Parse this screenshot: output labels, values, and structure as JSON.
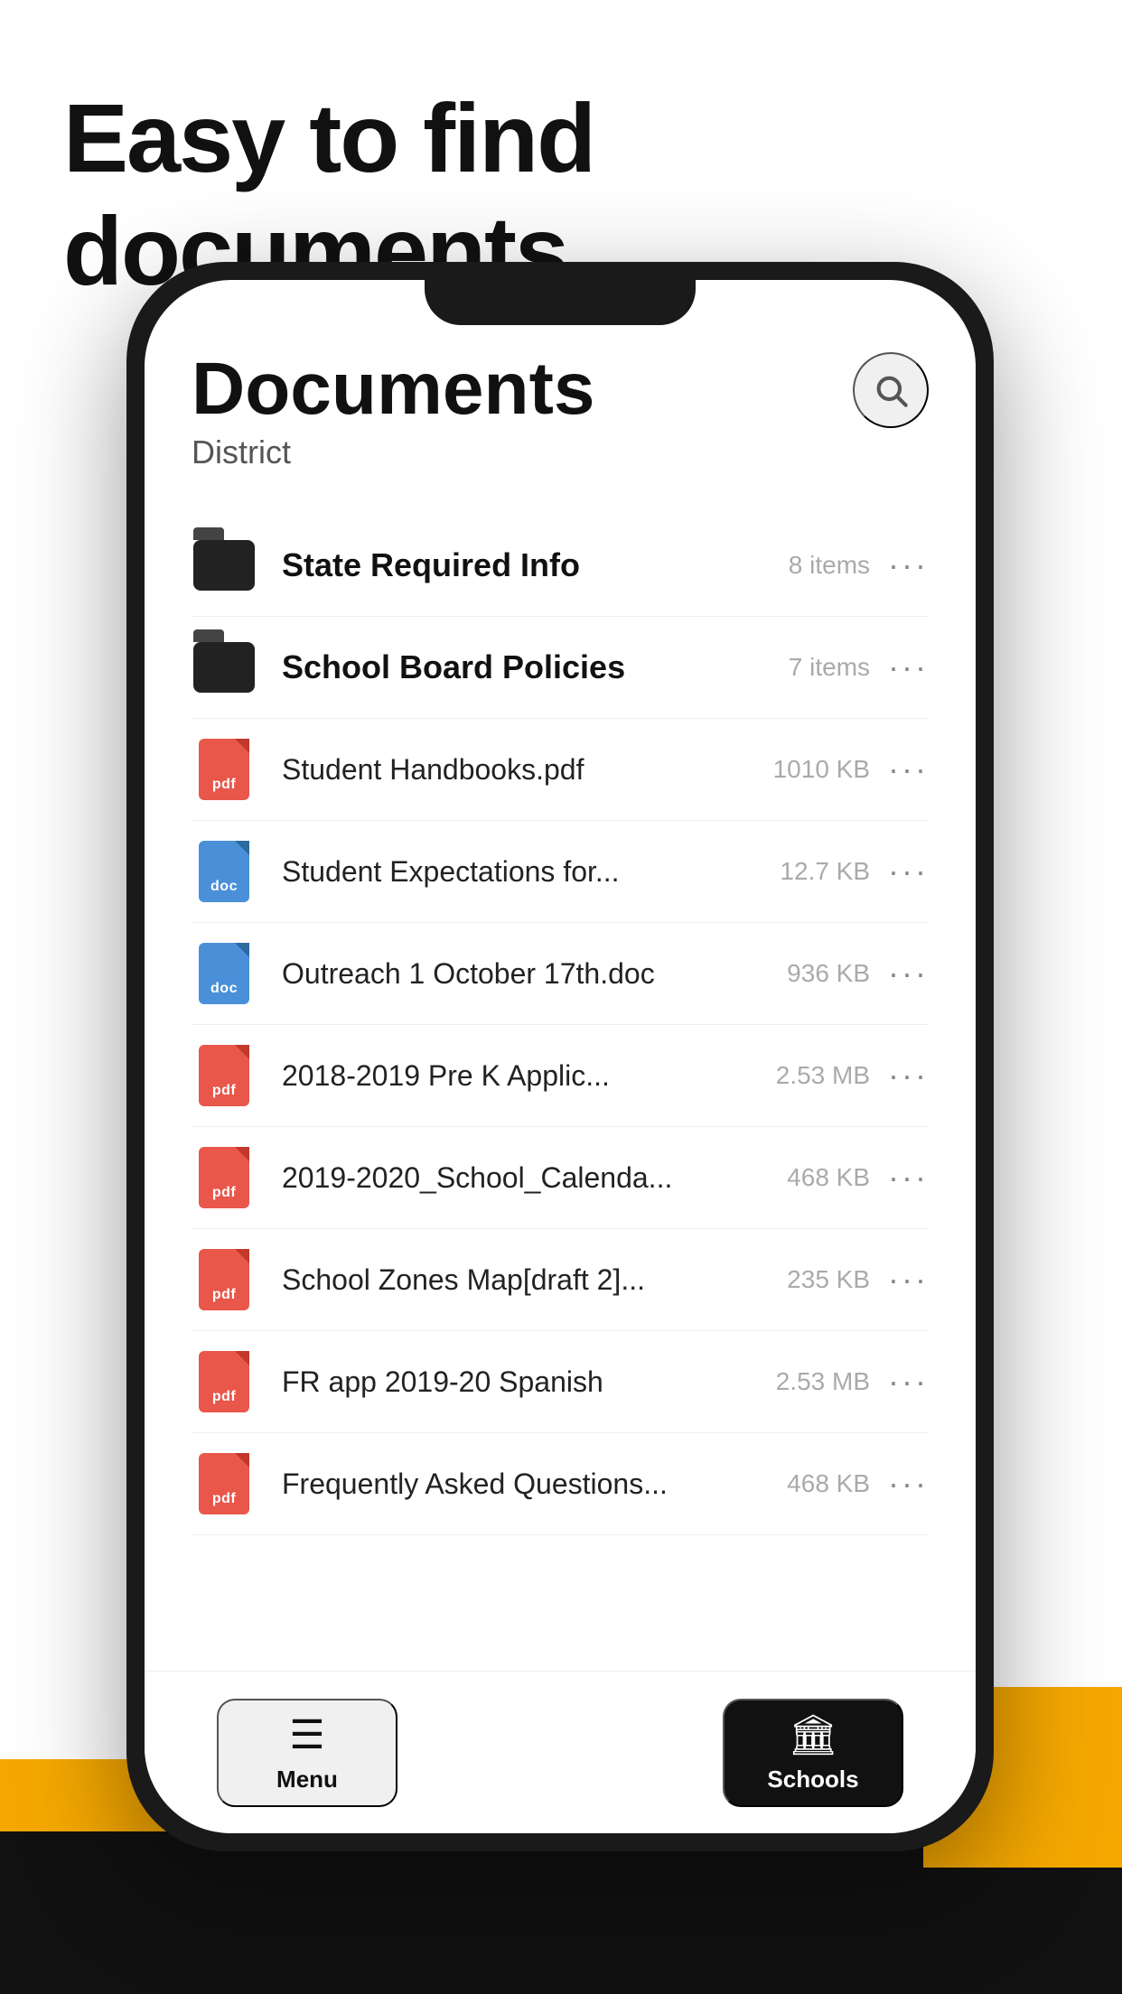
{
  "page": {
    "headline": "Easy to find documents"
  },
  "phone": {
    "header": {
      "title": "Documents",
      "subtitle": "District"
    },
    "files": [
      {
        "type": "folder",
        "name": "State Required Info",
        "size": "8 items"
      },
      {
        "type": "folder",
        "name": "School Board Policies",
        "size": "7 items"
      },
      {
        "type": "pdf",
        "name": "Student Handbooks.pdf",
        "size": "1010 KB"
      },
      {
        "type": "doc",
        "name": "Student Expectations for...",
        "size": "12.7 KB"
      },
      {
        "type": "doc",
        "name": "Outreach 1 October 17th.doc",
        "size": "936 KB"
      },
      {
        "type": "pdf",
        "name": "2018-2019 Pre K Applic...",
        "size": "2.53 MB"
      },
      {
        "type": "pdf",
        "name": "2019-2020_School_Calenda...",
        "size": "468 KB"
      },
      {
        "type": "pdf",
        "name": "School Zones Map[draft 2]...",
        "size": "235 KB"
      },
      {
        "type": "pdf",
        "name": "FR app 2019-20 Spanish",
        "size": "2.53 MB"
      },
      {
        "type": "pdf",
        "name": "Frequently Asked Questions...",
        "size": "468 KB"
      }
    ],
    "tabBar": {
      "menu": {
        "label": "Menu",
        "active": false
      },
      "schools": {
        "label": "Schools",
        "active": true
      }
    }
  }
}
